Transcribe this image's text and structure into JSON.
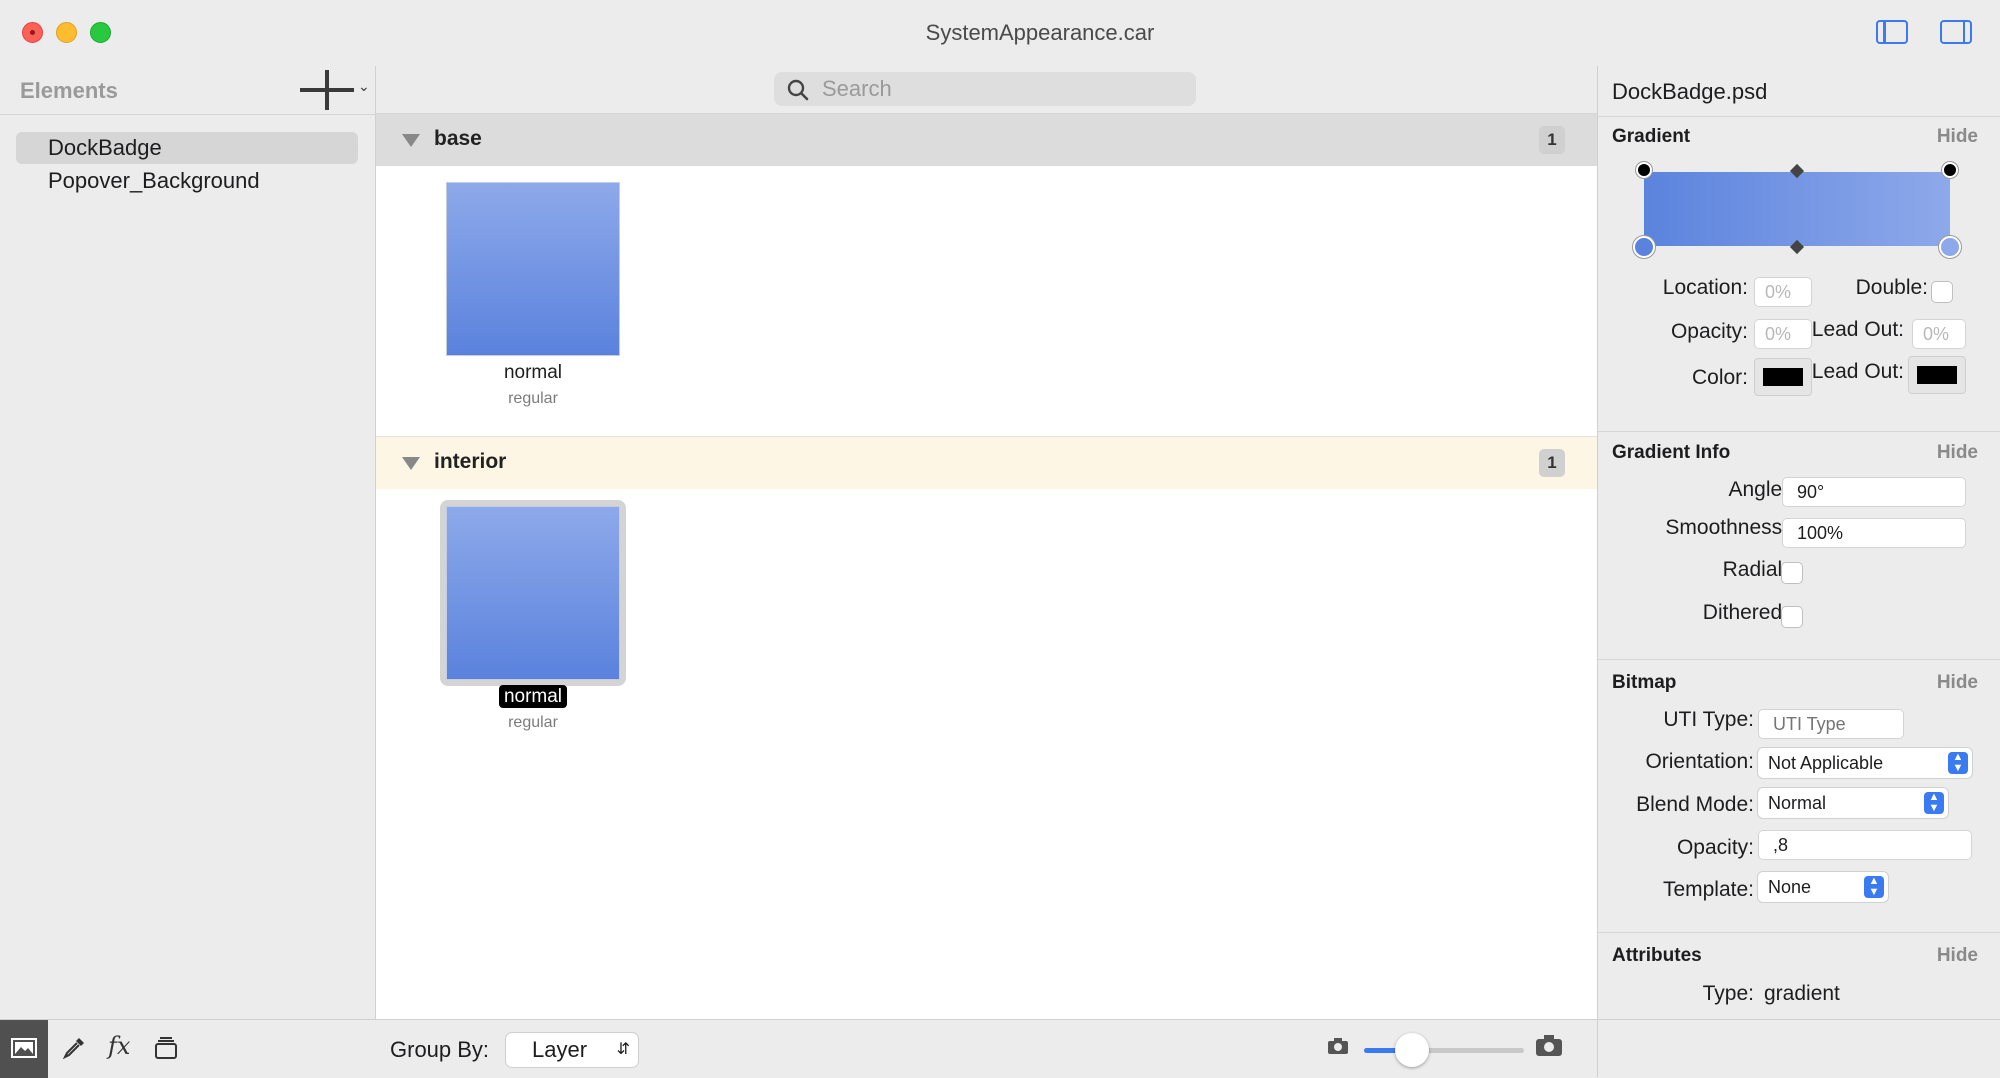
{
  "window": {
    "title": "SystemAppearance.car"
  },
  "sidebar": {
    "title": "Elements",
    "items": [
      {
        "label": "DockBadge",
        "selected": true
      },
      {
        "label": "Popover_Background",
        "selected": false
      }
    ]
  },
  "search": {
    "placeholder": "Search"
  },
  "groups": [
    {
      "name": "base",
      "count": "1",
      "items": [
        {
          "label": "normal",
          "sub": "regular"
        }
      ]
    },
    {
      "name": "interior",
      "count": "1",
      "items": [
        {
          "label": "normal",
          "sub": "regular"
        }
      ]
    }
  ],
  "bottom": {
    "group_by_label": "Group By:",
    "group_by_value": "Layer",
    "zoom_level": 0.3
  },
  "inspector": {
    "title": "DockBadge.psd",
    "hide_label": "Hide",
    "gradient": {
      "header": "Gradient",
      "location_label": "Location:",
      "location_value": "0%",
      "opacity_label": "Opacity:",
      "opacity_value": "0%",
      "color_label": "Color:",
      "double_label": "Double:",
      "lead_out_label": "Lead Out:",
      "lead_out_value": "0%",
      "lead_out_color_label": "Lead Out:",
      "start_color": "#5b83dd",
      "end_color": "#8ea9ea"
    },
    "gradient_info": {
      "header": "Gradient Info",
      "angle_label": "Angle:",
      "angle_value": "90°",
      "smoothness_label": "Smoothness:",
      "smoothness_value": "100%",
      "radial_label": "Radial:",
      "dithered_label": "Dithered:"
    },
    "bitmap": {
      "header": "Bitmap",
      "uti_label": "UTI Type:",
      "uti_placeholder": "UTI Type",
      "orientation_label": "Orientation:",
      "orientation_value": "Not Applicable",
      "blend_label": "Blend Mode:",
      "blend_value": "Normal",
      "opacity_label": "Opacity:",
      "opacity_value": ",8",
      "template_label": "Template:",
      "template_value": "None"
    },
    "attributes": {
      "header": "Attributes",
      "type_label": "Type:",
      "type_value": "gradient"
    }
  },
  "colors": {
    "accent": "#3b7bf2",
    "interior_header": "#fdf6e4",
    "base_header": "#dcdcdc"
  }
}
